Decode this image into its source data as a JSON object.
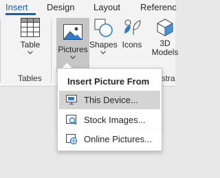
{
  "tabs": [
    {
      "label": "Insert",
      "active": true
    },
    {
      "label": "Design",
      "active": false
    },
    {
      "label": "Layout",
      "active": false
    },
    {
      "label": "Referenc",
      "active": false
    }
  ],
  "ribbon": {
    "table_button": "Table",
    "tables_group_label": "Tables",
    "pictures_button": "Pictures",
    "shapes_button": "Shapes",
    "icons_button": "Icons",
    "models_button_line1": "3D",
    "models_button_line2": "Models",
    "illustrations_group_label_partial": "ustra"
  },
  "menu": {
    "header": "Insert Picture From",
    "items": [
      {
        "label": "This Device...",
        "icon": "device-icon",
        "highlighted": true
      },
      {
        "label": "Stock Images...",
        "icon": "stock-images-icon",
        "highlighted": false
      },
      {
        "label": "Online Pictures...",
        "icon": "online-pictures-icon",
        "highlighted": false
      }
    ]
  },
  "colors": {
    "accent": "#185abd",
    "ribbon_bg": "#f3f3f3",
    "pressed_bg": "#c6c6c6",
    "menu_hover": "#d4d4d4"
  }
}
